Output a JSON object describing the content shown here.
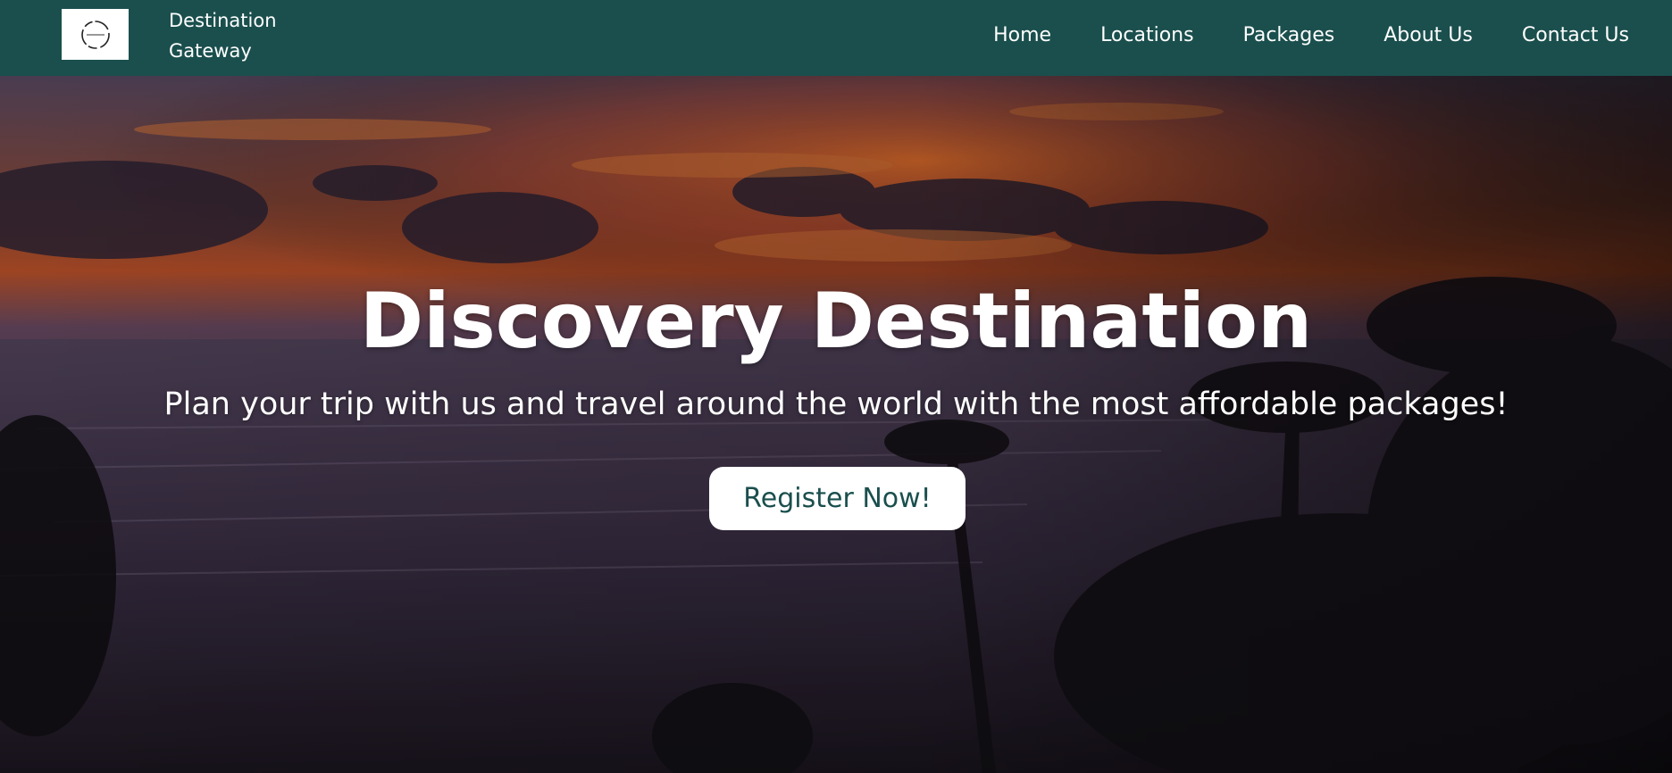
{
  "nav": {
    "brand_line1": "Destination",
    "brand_line2": "Gateway",
    "links": [
      "Home",
      "Locations",
      "Packages",
      "About Us",
      "Contact Us"
    ],
    "background_color": "#1a4f4d",
    "logo_icon": "circle-logo-icon"
  },
  "hero": {
    "title": "Discovery Destination",
    "subtitle": "Plan your trip with us and travel around the world with the most affordable packages!",
    "button_label": "Register Now!",
    "button_text_color": "#1a4f4d",
    "background": "sunset-beach-with-palm-trees"
  }
}
